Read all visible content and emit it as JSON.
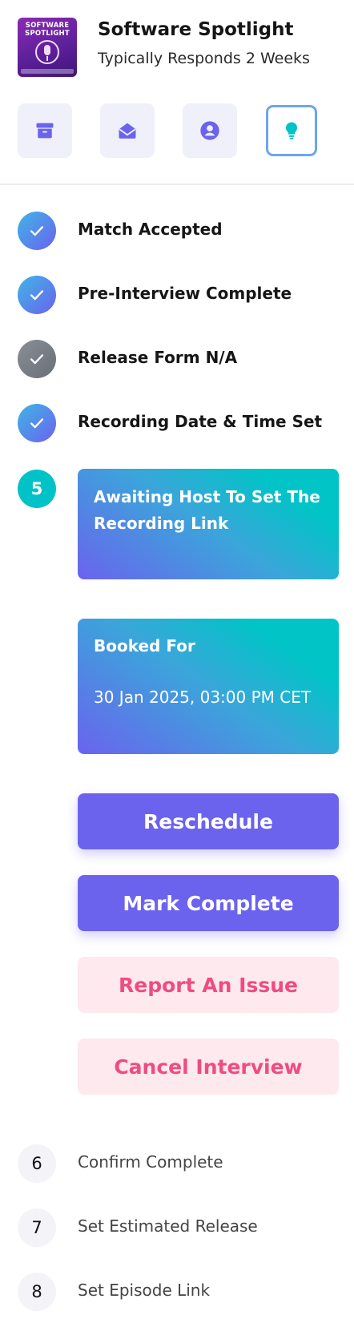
{
  "header": {
    "logo_text": "SOFTWARE SPOTLIGHT",
    "title": "Software Spotlight",
    "subtitle": "Typically Responds 2 Weeks",
    "icon_buttons": [
      {
        "icon": "archive-icon"
      },
      {
        "icon": "envelope-open-icon"
      },
      {
        "icon": "user-profile-icon"
      },
      {
        "icon": "lightbulb-icon",
        "active": true
      }
    ]
  },
  "steps": [
    {
      "status": "done",
      "label": "Match Accepted"
    },
    {
      "status": "done",
      "label": "Pre-Interview Complete"
    },
    {
      "status": "na",
      "label": "Release Form N/A"
    },
    {
      "status": "done",
      "label": "Recording Date & Time Set"
    },
    {
      "status": "current",
      "number": "5",
      "card_title": "Awaiting Host To Set The Recording Link"
    },
    {
      "status": "pending",
      "number": "6",
      "label": "Confirm Complete"
    },
    {
      "status": "pending",
      "number": "7",
      "label": "Set Estimated Release"
    },
    {
      "status": "pending",
      "number": "8",
      "label": "Set Episode Link"
    }
  ],
  "booking": {
    "title": "Booked For",
    "datetime": "30 Jan 2025, 03:00 PM CET"
  },
  "actions": {
    "reschedule": "Reschedule",
    "mark_complete": "Mark Complete",
    "report_issue": "Report An Issue",
    "cancel_interview": "Cancel Interview"
  },
  "colors": {
    "accent": "#6b63ee",
    "teal": "#00c2c7",
    "danger_text": "#ef4c7f",
    "danger_bg": "#fde9ee"
  }
}
